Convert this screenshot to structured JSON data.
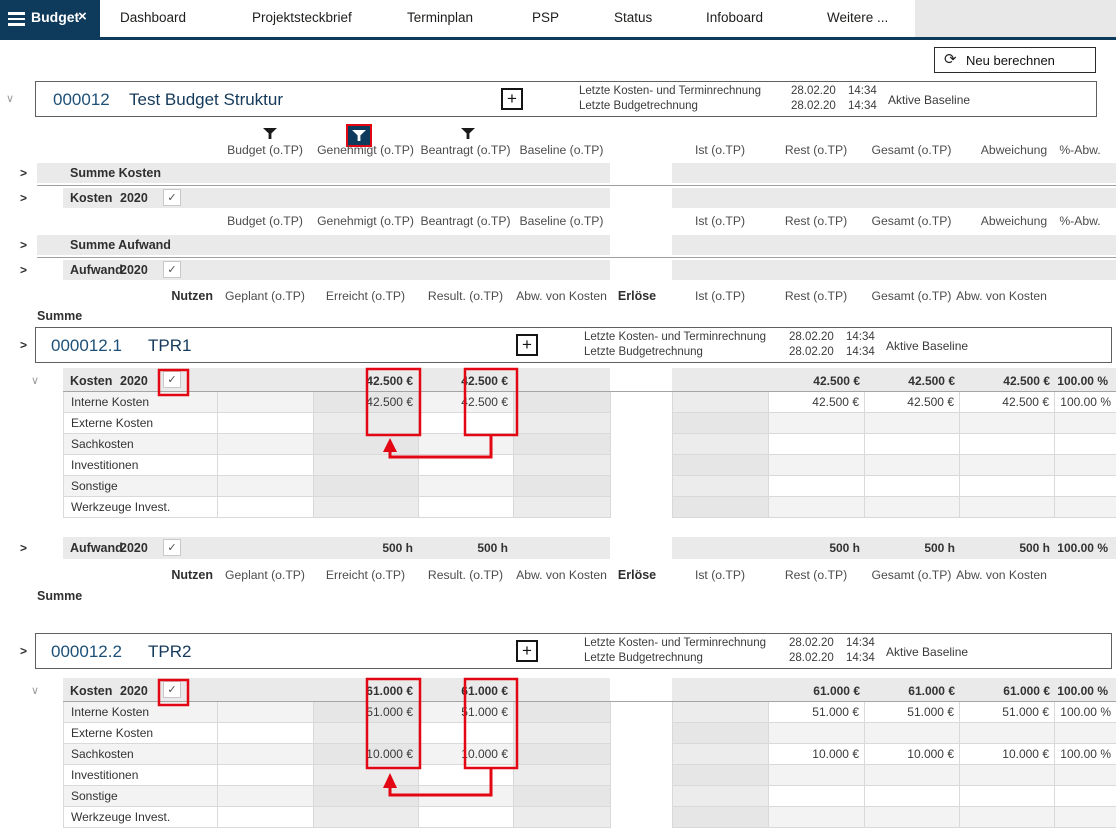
{
  "colors": {
    "navy": "#0e3a5b",
    "annotation_red": "#e30613",
    "bar_gray": "#eaeaea",
    "column_gray": "#ececec"
  },
  "nav": {
    "active_tab": "Budget",
    "close_label": "×",
    "tabs": [
      "Dashboard",
      "Projektsteckbrief",
      "Terminplan",
      "PSP",
      "Status",
      "Infoboard",
      "Weitere ..."
    ]
  },
  "toolbar": {
    "recalculate_label": "Neu berechnen",
    "recalculate_icon": "⟳"
  },
  "meta": {
    "row1_label": "Letzte Kosten- und Terminrechnung",
    "row2_label": "Letzte Budgetrechnung",
    "date": "28.02.20",
    "time": "14:34",
    "baseline": "Aktive Baseline",
    "plus": "+"
  },
  "glyphs": {
    "chevron_right": ">",
    "chevron_down": "∨",
    "check": "✓"
  },
  "columns": {
    "left": [
      "Budget (o.TP)",
      "Genehmigt (o.TP)",
      "Beantragt (o.TP)",
      "Baseline (o.TP)"
    ],
    "right": [
      "Ist (o.TP)",
      "Rest (o.TP)",
      "Gesamt (o.TP)",
      "Abweichung",
      "%-Abw."
    ]
  },
  "nutzen": {
    "label": "Nutzen",
    "left": [
      "Geplant (o.TP)",
      "Erreicht (o.TP)",
      "Result. (o.TP)",
      "Abw. von Kosten"
    ],
    "erloese": "Erlöse",
    "right": [
      "Ist (o.TP)",
      "Rest (o.TP)",
      "Gesamt (o.TP)",
      "Abw. von Kosten"
    ],
    "summe": "Summe"
  },
  "project": {
    "id": "000012",
    "title": "Test Budget Struktur",
    "summe_kosten": "Summe Kosten",
    "kosten_label": "Kosten",
    "kosten_year": "2020",
    "summe_aufwand": "Summe Aufwand",
    "aufwand_label": "Aufwand",
    "aufwand_year": "2020"
  },
  "sections": [
    {
      "id": "000012.1",
      "name": "TPR1",
      "kosten": {
        "label": "Kosten",
        "year": "2020",
        "left": [
          "",
          "42.500 €",
          "42.500 €",
          ""
        ],
        "right": [
          "",
          "42.500 €",
          "42.500 €",
          "42.500 €",
          "100.00 %"
        ]
      },
      "subrows": [
        {
          "label": "Interne Kosten",
          "left": [
            "",
            "42.500 €",
            "42.500 €",
            ""
          ],
          "right": [
            "",
            "42.500 €",
            "42.500 €",
            "42.500 €",
            "100.00 %"
          ]
        },
        {
          "label": "Externe Kosten",
          "left": [
            "",
            "",
            "",
            ""
          ],
          "right": [
            "",
            "",
            "",
            "",
            ""
          ]
        },
        {
          "label": "Sachkosten",
          "left": [
            "",
            "",
            "",
            ""
          ],
          "right": [
            "",
            "",
            "",
            "",
            ""
          ]
        },
        {
          "label": "Investitionen",
          "left": [
            "",
            "",
            "",
            ""
          ],
          "right": [
            "",
            "",
            "",
            "",
            ""
          ]
        },
        {
          "label": "Sonstige",
          "left": [
            "",
            "",
            "",
            ""
          ],
          "right": [
            "",
            "",
            "",
            "",
            ""
          ]
        },
        {
          "label": "Werkzeuge Invest.",
          "left": [
            "",
            "",
            "",
            ""
          ],
          "right": [
            "",
            "",
            "",
            "",
            ""
          ]
        }
      ],
      "aufwand": {
        "label": "Aufwand",
        "year": "2020",
        "left": [
          "",
          "500 h",
          "500 h",
          ""
        ],
        "right": [
          "",
          "500 h",
          "500 h",
          "500 h",
          "100.00 %"
        ]
      }
    },
    {
      "id": "000012.2",
      "name": "TPR2",
      "kosten": {
        "label": "Kosten",
        "year": "2020",
        "left": [
          "",
          "61.000 €",
          "61.000 €",
          ""
        ],
        "right": [
          "",
          "61.000 €",
          "61.000 €",
          "61.000 €",
          "100.00 %"
        ]
      },
      "subrows": [
        {
          "label": "Interne Kosten",
          "left": [
            "",
            "51.000 €",
            "51.000 €",
            ""
          ],
          "right": [
            "",
            "51.000 €",
            "51.000 €",
            "51.000 €",
            "100.00 %"
          ]
        },
        {
          "label": "Externe Kosten",
          "left": [
            "",
            "",
            "",
            ""
          ],
          "right": [
            "",
            "",
            "",
            "",
            ""
          ]
        },
        {
          "label": "Sachkosten",
          "left": [
            "",
            "10.000 €",
            "10.000 €",
            ""
          ],
          "right": [
            "",
            "10.000 €",
            "10.000 €",
            "10.000 €",
            "100.00 %"
          ]
        },
        {
          "label": "Investitionen",
          "left": [
            "",
            "",
            "",
            ""
          ],
          "right": [
            "",
            "",
            "",
            "",
            ""
          ]
        },
        {
          "label": "Sonstige",
          "left": [
            "",
            "",
            "",
            ""
          ],
          "right": [
            "",
            "",
            "",
            "",
            ""
          ]
        },
        {
          "label": "Werkzeuge Invest.",
          "left": [
            "",
            "",
            "",
            ""
          ],
          "right": [
            "",
            "",
            "",
            "",
            ""
          ]
        }
      ]
    }
  ]
}
